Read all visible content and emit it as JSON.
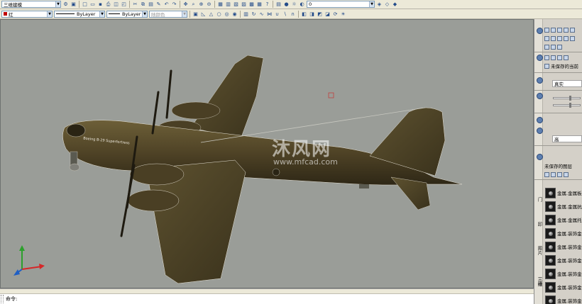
{
  "toolbar_top": {
    "workspace": "三维建模",
    "layer_value": "0"
  },
  "toolbar_props": {
    "color": "红",
    "linetype": "ByLayer",
    "lineweight": "ByLayer",
    "plotstyle": "随颜色"
  },
  "viewport": {
    "watermark_cn": "沐风网",
    "watermark_url": "www.mfcad.com",
    "model_label": "Boeing B-29 Superfortress"
  },
  "command_line": {
    "prompt": "命令:"
  },
  "right_panel": {
    "unsaved_view": "未保存的当前",
    "visual_style": "真实",
    "scale_label": "高",
    "unsaved_layer": "未保存的图层",
    "tabs": [
      "门",
      "卸",
      "图片",
      "三维"
    ],
    "materials": [
      "金属.金属板",
      "金属.金属抗",
      "金属.金属托",
      "金属.装饰金",
      "金属.装饰金",
      "金属.装饰金",
      "金属.装饰金",
      "金属.装饰金",
      "金属.装饰金"
    ]
  },
  "colors": {
    "viewport_bg": "#9a9d98",
    "model_body": "#4f4326",
    "accent_red": "#c00000"
  }
}
